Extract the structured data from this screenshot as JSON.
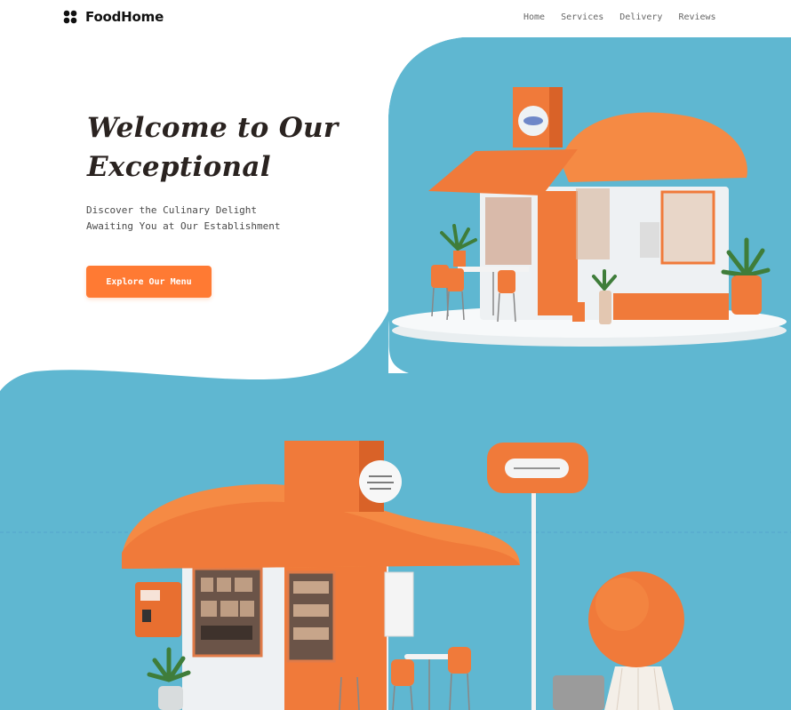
{
  "brand": {
    "name": "FoodHome",
    "logo_icon": "four-dots-icon"
  },
  "nav": [
    {
      "label": "Home"
    },
    {
      "label": "Services"
    },
    {
      "label": "Delivery"
    },
    {
      "label": "Reviews"
    }
  ],
  "hero": {
    "title_line1": "Welcome to Our",
    "title_line2": "Exceptional",
    "subtitle_line1": "Discover the Culinary Delight",
    "subtitle_line2": "Awaiting You at Our Establishment",
    "cta_label": "Explore Our Menu"
  },
  "colors": {
    "accent": "#ff7a33",
    "sky": "#5fb7d1",
    "text": "#2a2320"
  }
}
